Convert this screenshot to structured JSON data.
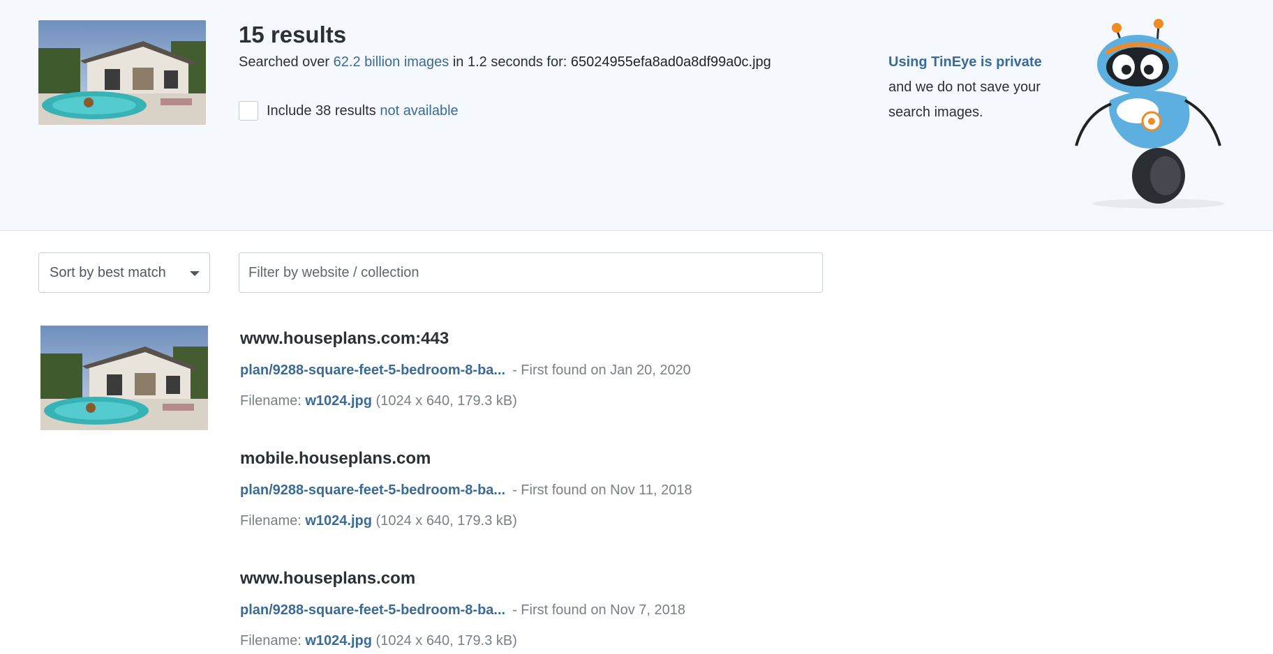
{
  "header": {
    "results_count": "15 results",
    "searched_prefix": "Searched over ",
    "searched_link": "62.2 billion images",
    "searched_mid": " in 1.2 seconds for: ",
    "query_filename": "65024955efa8ad0a8df99a0c.jpg",
    "include_prefix": "Include 38 results ",
    "include_link": "not available"
  },
  "privacy": {
    "link": "Using TinEye is private",
    "text": "and we do not save your search images."
  },
  "controls": {
    "sort_label": "Sort by best match",
    "filter_placeholder": "Filter by website / collection"
  },
  "results": [
    {
      "domain": "www.houseplans.com:443",
      "path": "plan/9288-square-feet-5-bedroom-8-ba...",
      "found": "- First found on Jan 20, 2020",
      "filename_label": "Filename: ",
      "filename": "w1024.jpg",
      "file_info": "(1024 x 640, 179.3 kB)"
    },
    {
      "domain": "mobile.houseplans.com",
      "path": "plan/9288-square-feet-5-bedroom-8-ba...",
      "found": "- First found on Nov 11, 2018",
      "filename_label": "Filename: ",
      "filename": "w1024.jpg",
      "file_info": "(1024 x 640, 179.3 kB)"
    },
    {
      "domain": "www.houseplans.com",
      "path": "plan/9288-square-feet-5-bedroom-8-ba...",
      "found": "- First found on Nov 7, 2018",
      "filename_label": "Filename: ",
      "filename": "w1024.jpg",
      "file_info": "(1024 x 640, 179.3 kB)"
    }
  ],
  "colors": {
    "link": "#3a6a98",
    "header_bg": "#f5f8fc",
    "text": "#2b2f36",
    "muted": "#7a7f87"
  }
}
